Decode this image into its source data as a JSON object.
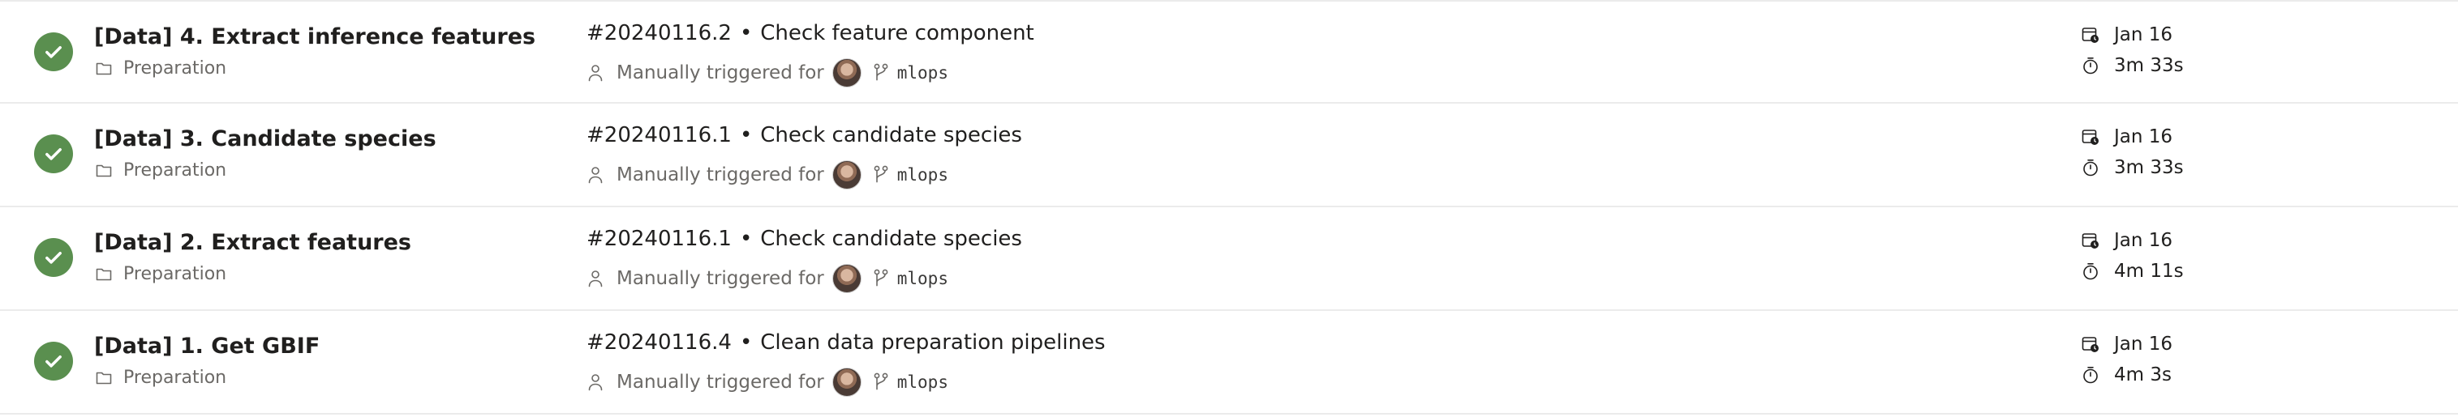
{
  "runs": [
    {
      "name": "[Data] 4. Extract inference features",
      "folder": "Preparation",
      "run_id": "#20240116.2",
      "separator": "•",
      "commit_message": "Check feature component",
      "trigger_text": "Manually triggered for",
      "branch": "mlops",
      "date": "Jan 16",
      "duration": "3m 33s",
      "status": "succeeded"
    },
    {
      "name": "[Data] 3. Candidate species",
      "folder": "Preparation",
      "run_id": "#20240116.1",
      "separator": "•",
      "commit_message": "Check candidate species",
      "trigger_text": "Manually triggered for",
      "branch": "mlops",
      "date": "Jan 16",
      "duration": "3m 33s",
      "status": "succeeded"
    },
    {
      "name": "[Data] 2. Extract features",
      "folder": "Preparation",
      "run_id": "#20240116.1",
      "separator": "•",
      "commit_message": "Check candidate species",
      "trigger_text": "Manually triggered for",
      "branch": "mlops",
      "date": "Jan 16",
      "duration": "4m 11s",
      "status": "succeeded"
    },
    {
      "name": "[Data] 1. Get GBIF",
      "folder": "Preparation",
      "run_id": "#20240116.4",
      "separator": "•",
      "commit_message": "Clean data preparation pipelines",
      "trigger_text": "Manually triggered for",
      "branch": "mlops",
      "date": "Jan 16",
      "duration": "4m 3s",
      "status": "succeeded"
    }
  ],
  "colors": {
    "success": "#5a8f4f",
    "text_primary": "#201f1e",
    "text_secondary": "#6b6966",
    "divider": "#ebebeb"
  },
  "icons": {
    "status": "check-circle-icon",
    "folder": "folder-icon",
    "trigger": "person-icon",
    "branch": "branch-icon",
    "date": "calendar-clock-icon",
    "duration": "stopwatch-icon"
  }
}
